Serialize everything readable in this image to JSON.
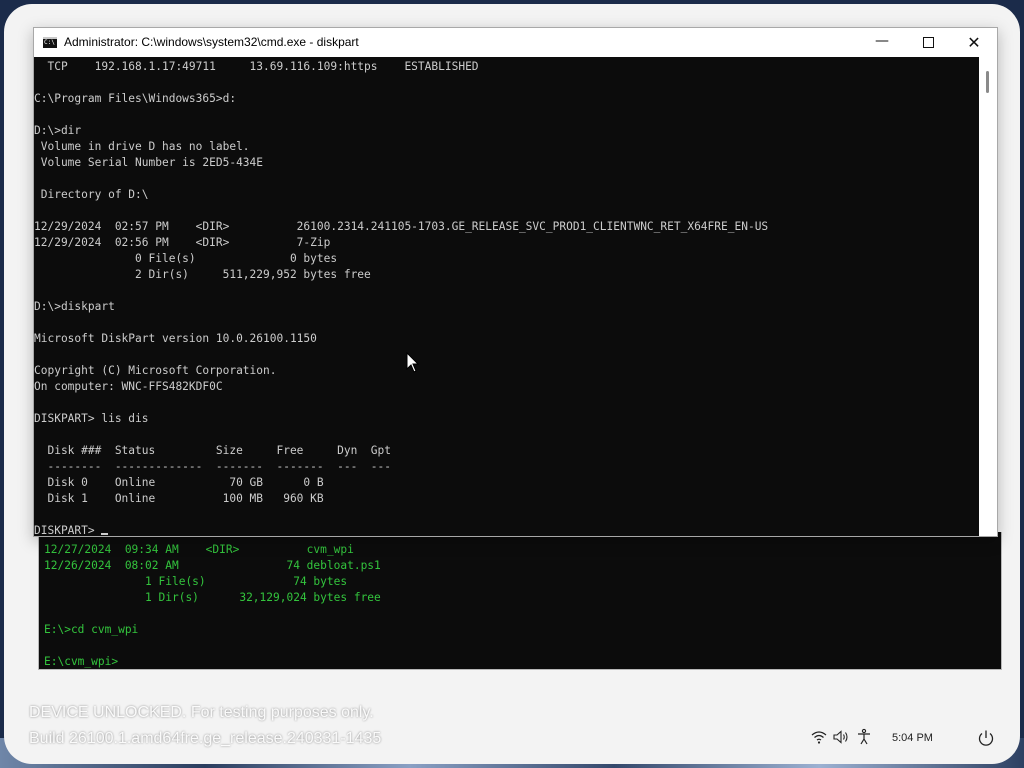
{
  "window": {
    "title": "Administrator: C:\\windows\\system32\\cmd.exe - diskpart",
    "icon": "cmd-icon",
    "icon_text": "C:\\",
    "minimize_glyph": "—",
    "close_glyph": "✕"
  },
  "console_lines": [
    "  TCP    192.168.1.17:49711     13.69.116.109:https    ESTABLISHED",
    "",
    "C:\\Program Files\\Windows365>d:",
    "",
    "D:\\>dir",
    " Volume in drive D has no label.",
    " Volume Serial Number is 2ED5-434E",
    "",
    " Directory of D:\\",
    "",
    "12/29/2024  02:57 PM    <DIR>          26100.2314.241105-1703.GE_RELEASE_SVC_PROD1_CLIENTWNC_RET_X64FRE_EN-US",
    "12/29/2024  02:56 PM    <DIR>          7-Zip",
    "               0 File(s)              0 bytes",
    "               2 Dir(s)     511,229,952 bytes free",
    "",
    "D:\\>diskpart",
    "",
    "Microsoft DiskPart version 10.0.26100.1150",
    "",
    "Copyright (C) Microsoft Corporation.",
    "On computer: WNC-FFS482KDF0C",
    "",
    "DISKPART> lis dis",
    "",
    "  Disk ###  Status         Size     Free     Dyn  Gpt",
    "  --------  -------------  -------  -------  ---  ---",
    "  Disk 0    Online           70 GB      0 B",
    "  Disk 1    Online          100 MB   960 KB",
    ""
  ],
  "prompt": "DISKPART> ",
  "background_console_lines": [
    "12/27/2024  09:34 AM    <DIR>          cvm_wpi",
    "12/26/2024  08:02 AM                74 debloat.ps1",
    "               1 File(s)             74 bytes",
    "               1 Dir(s)      32,129,024 bytes free",
    "",
    "E:\\>cd cvm_wpi",
    "",
    "E:\\cvm_wpi>"
  ],
  "watermark": {
    "line1": "DEVICE UNLOCKED. For testing purposes only.",
    "line2": "Build 26100.1.amd64fre.ge_release.240331-1435"
  },
  "tray": {
    "icons": [
      "wifi-icon",
      "volume-icon",
      "accessibility-icon"
    ],
    "time": "5:04 PM",
    "power_icon": "power-icon"
  },
  "colors": {
    "console_bg": "#0c0c0c",
    "console_text": "#cccccc",
    "green_text": "#33c43d",
    "desktop_bg": "#f3f3f3"
  }
}
